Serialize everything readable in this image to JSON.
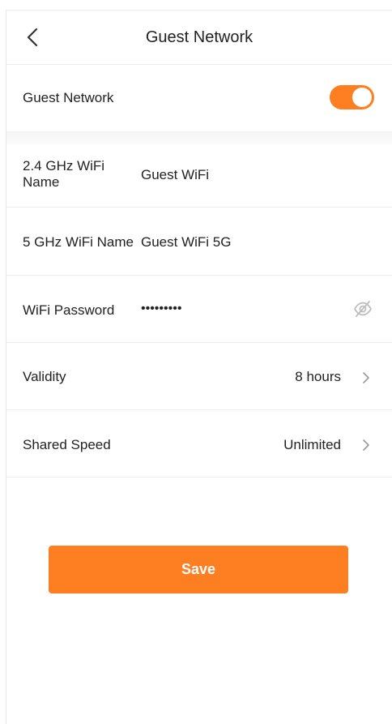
{
  "header": {
    "title": "Guest Network",
    "back_icon": "chevron-left-icon"
  },
  "guest_toggle": {
    "label": "Guest Network",
    "on": true
  },
  "fields": {
    "wifi_24_label": "2.4 GHz WiFi Name",
    "wifi_24_value": "Guest WiFi",
    "wifi_5_label": "5 GHz WiFi Name",
    "wifi_5_value": "Guest WiFi 5G",
    "password_label": "WiFi Password",
    "password_value": "•••••••••",
    "password_icon": "eye-hidden-icon",
    "validity_label": "Validity",
    "validity_value": "8 hours",
    "speed_label": "Shared Speed",
    "speed_value": "Unlimited"
  },
  "actions": {
    "save_label": "Save"
  },
  "colors": {
    "accent": "#fd7f22",
    "icon_gray": "#bdbdbd"
  }
}
